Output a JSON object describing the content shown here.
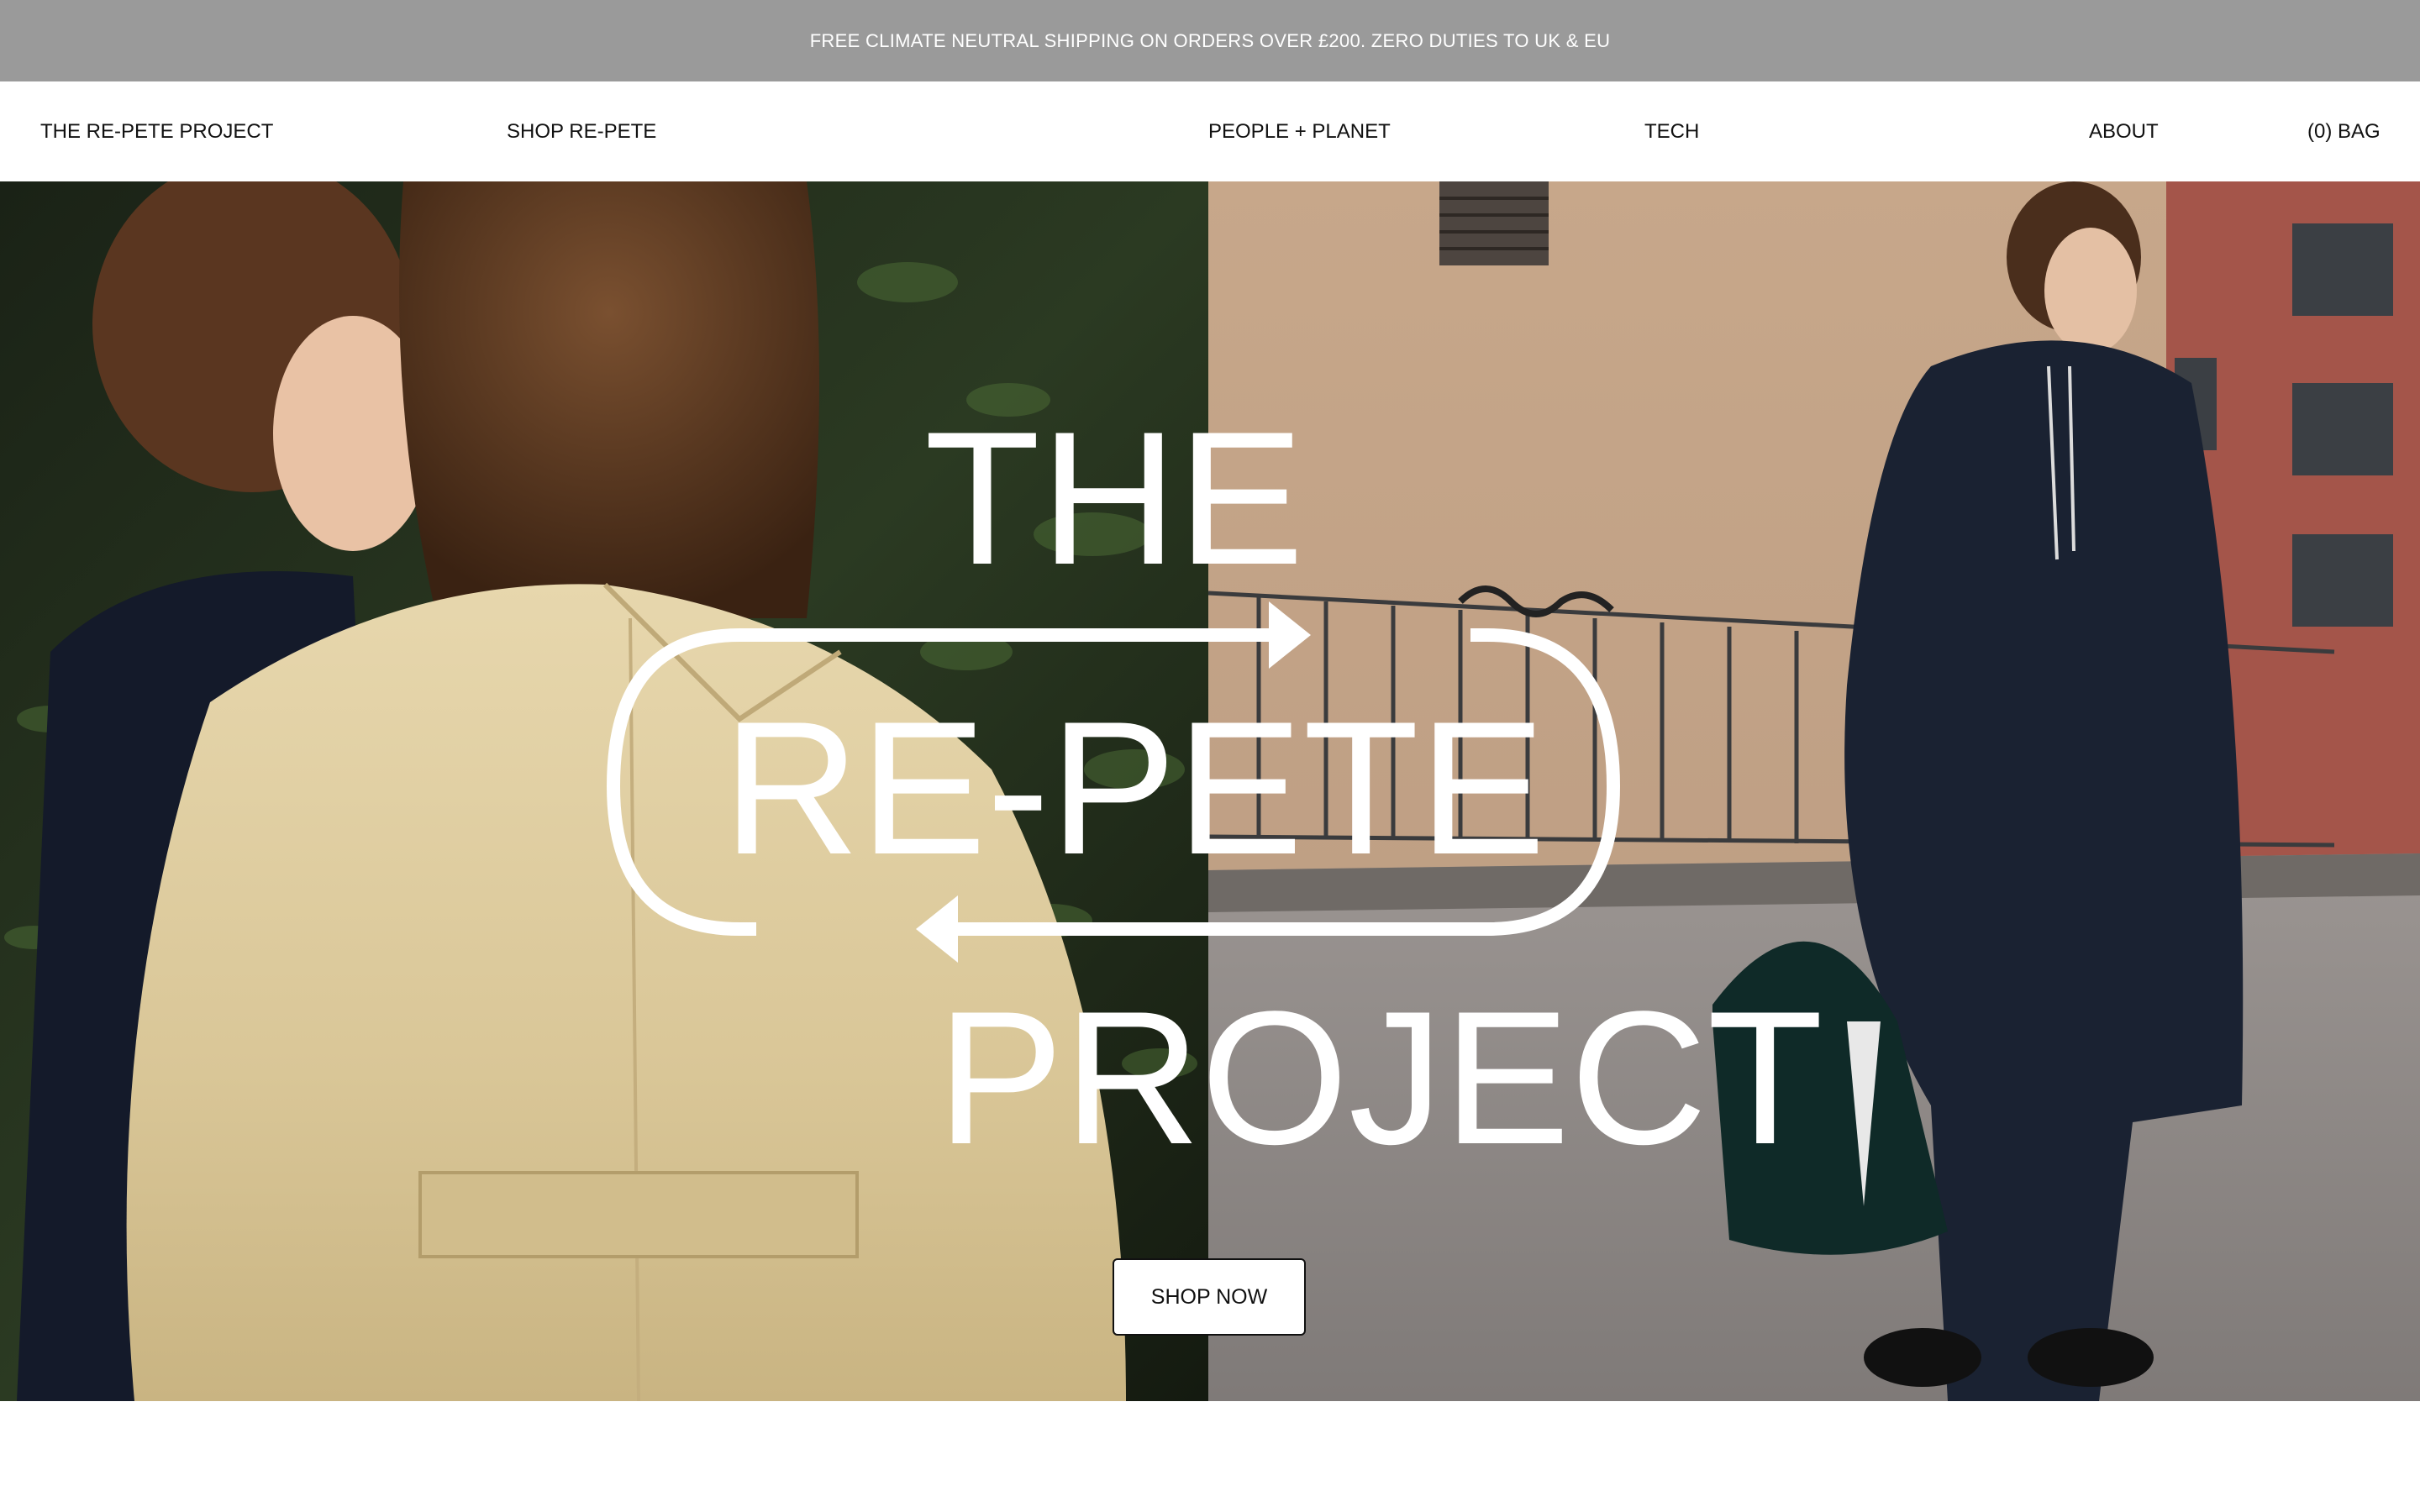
{
  "announcement": {
    "text": "FREE CLIMATE NEUTRAL SHIPPING ON ORDERS OVER £200. ZERO DUTIES TO UK & EU"
  },
  "nav": {
    "brand": "THE RE-PETE PROJECT",
    "items": [
      {
        "label": "SHOP RE-PETE"
      },
      {
        "label": "PEOPLE + PLANET"
      },
      {
        "label": "TECH"
      },
      {
        "label": "ABOUT"
      }
    ],
    "bag": "(0) BAG"
  },
  "hero": {
    "logo": {
      "line1": "THE",
      "line2": "RE-PETE",
      "line3": "PROJECT"
    },
    "cta": "SHOP NOW"
  },
  "colors": {
    "announcement_bg": "#9a9a9a",
    "announcement_text": "#ffffff",
    "nav_bg": "#ffffff",
    "text": "#111111",
    "logo": "#ffffff"
  }
}
